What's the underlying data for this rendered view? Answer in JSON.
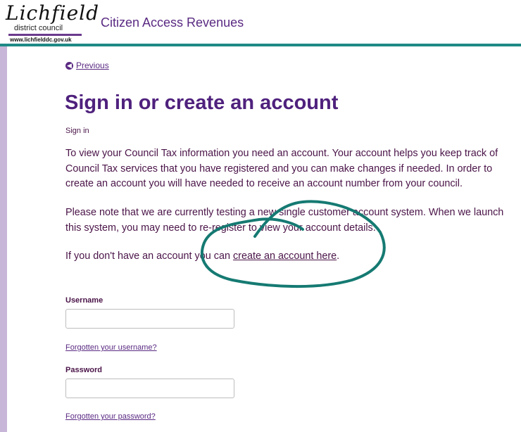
{
  "header": {
    "logo_word": "Lichfield",
    "logo_sub": "district council",
    "logo_url": "www.lichfielddc.gov.uk",
    "app_title": "Citizen Access Revenues"
  },
  "nav": {
    "previous_label": "Previous"
  },
  "page": {
    "title": "Sign in or create an account",
    "breadcrumb": "Sign in",
    "para1": "To view your Council Tax information you need an account. Your account helps you keep track of Council Tax services that you have registered and you can make changes if needed. In order to create an account you will have needed to receive an account number from your council.",
    "para2": "Please note that we are currently testing a new single customer account system. When we launch this system, you may need to re-register to view your account details.",
    "para3_prefix": "If you don't have an account you can ",
    "para3_link": "create an account here",
    "para3_suffix": "."
  },
  "form": {
    "username_label": "Username",
    "username_value": "",
    "forgot_username": "Forgotten your username?",
    "password_label": "Password",
    "password_value": "",
    "forgot_password": "Forgotten your password?"
  },
  "colors": {
    "brand_purple": "#4f217d",
    "header_rule_teal": "#1e8a86",
    "annotation_teal": "#157a72",
    "side_strip": "#c7b6d8"
  },
  "icons": {
    "previous": "circle-arrow-left-icon"
  }
}
